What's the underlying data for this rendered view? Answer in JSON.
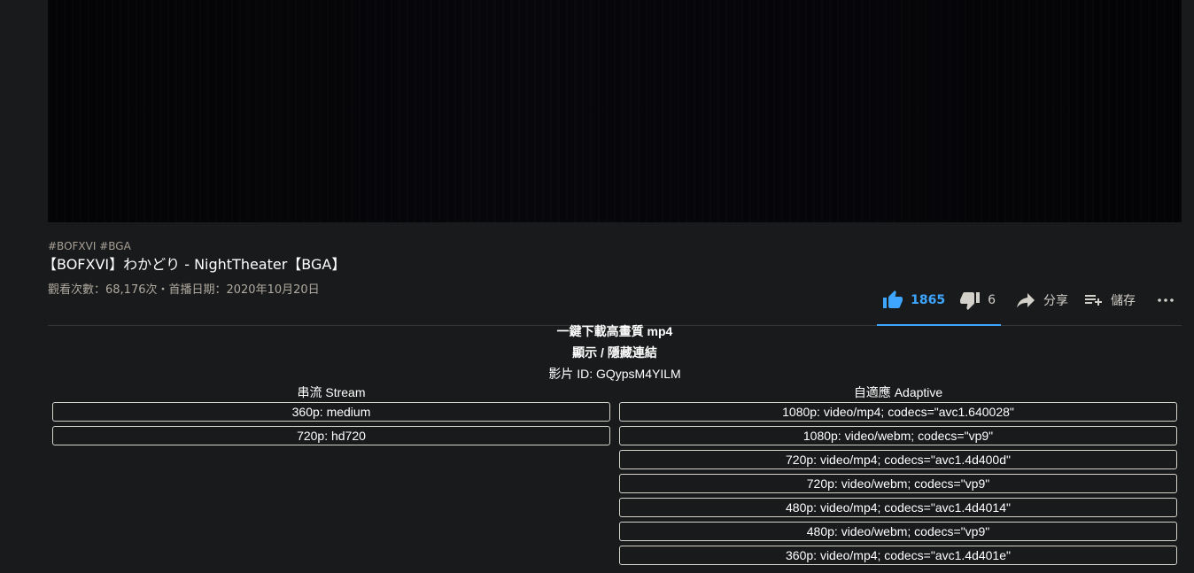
{
  "video": {
    "hashtags": "#BOFXVI #BGA",
    "title": "【BOFXVI】わかどり - NightTheater【BGA】",
    "views_line": "觀看次數：68,176次・首播日期：2020年10月20日"
  },
  "actions": {
    "like_count": "1865",
    "dislike_count": "6",
    "share_label": "分享",
    "save_label": "儲存",
    "like_icon": "thumbs-up-icon",
    "dislike_icon": "thumbs-down-icon",
    "share_icon": "share-arrow-icon",
    "save_icon": "playlist-add-icon",
    "more_icon": "more-horizontal-icon"
  },
  "downloader": {
    "quick_download": "一鍵下載高畫質 mp4",
    "toggle_links": "顯示 / 隱藏連結",
    "video_id_line": "影片 ID: GQypsM4YILM",
    "stream": {
      "header": "串流 Stream",
      "items": [
        "360p: medium",
        "720p: hd720"
      ]
    },
    "adaptive": {
      "header": "自適應 Adaptive",
      "items": [
        "1080p: video/mp4; codecs=\"avc1.640028\"",
        "1080p: video/webm; codecs=\"vp9\"",
        "720p: video/mp4; codecs=\"avc1.4d400d\"",
        "720p: video/webm; codecs=\"vp9\"",
        "480p: video/mp4; codecs=\"avc1.4d4014\"",
        "480p: video/webm; codecs=\"vp9\"",
        "360p: video/mp4; codecs=\"avc1.4d401e\""
      ]
    }
  },
  "colors": {
    "background": "#181a1b",
    "accent": "#3ea6ff",
    "text": "#ffffff",
    "muted": "#b0a99f"
  }
}
